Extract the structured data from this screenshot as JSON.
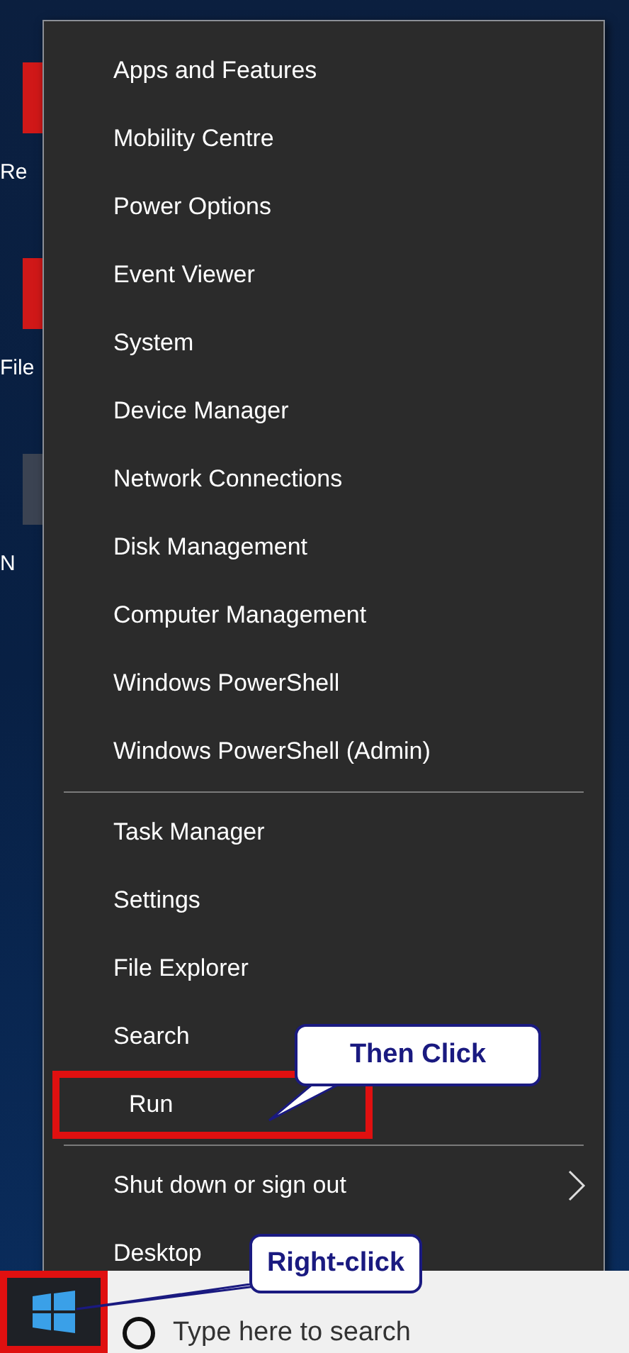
{
  "desktop_icons": [
    {
      "label": "Re",
      "color": "#d01818"
    },
    {
      "label": "File",
      "color": "#d01818"
    },
    {
      "label": "N",
      "color": "#3b4352"
    }
  ],
  "menu": {
    "groups": [
      [
        {
          "label": "Apps and Features",
          "annotated": false,
          "submenu": false
        },
        {
          "label": "Mobility Centre",
          "annotated": false,
          "submenu": false
        },
        {
          "label": "Power Options",
          "annotated": false,
          "submenu": false
        },
        {
          "label": "Event Viewer",
          "annotated": false,
          "submenu": false
        },
        {
          "label": "System",
          "annotated": false,
          "submenu": false
        },
        {
          "label": "Device Manager",
          "annotated": false,
          "submenu": false
        },
        {
          "label": "Network Connections",
          "annotated": false,
          "submenu": false
        },
        {
          "label": "Disk Management",
          "annotated": false,
          "submenu": false
        },
        {
          "label": "Computer Management",
          "annotated": false,
          "submenu": false
        },
        {
          "label": "Windows PowerShell",
          "annotated": false,
          "submenu": false
        },
        {
          "label": "Windows PowerShell (Admin)",
          "annotated": false,
          "submenu": false
        }
      ],
      [
        {
          "label": "Task Manager",
          "annotated": false,
          "submenu": false
        },
        {
          "label": "Settings",
          "annotated": false,
          "submenu": false
        },
        {
          "label": "File Explorer",
          "annotated": false,
          "submenu": false
        },
        {
          "label": "Search",
          "annotated": false,
          "submenu": false
        },
        {
          "label": "Run",
          "annotated": true,
          "submenu": false
        }
      ],
      [
        {
          "label": "Shut down or sign out",
          "annotated": false,
          "submenu": true
        },
        {
          "label": "Desktop",
          "annotated": false,
          "submenu": false
        }
      ]
    ]
  },
  "callouts": [
    {
      "text": "Then Click",
      "kind": "menu"
    },
    {
      "text": "Right-click",
      "kind": "start"
    }
  ],
  "taskbar": {
    "search": {
      "placeholder": "Type here to search"
    },
    "start_annotated": true
  }
}
